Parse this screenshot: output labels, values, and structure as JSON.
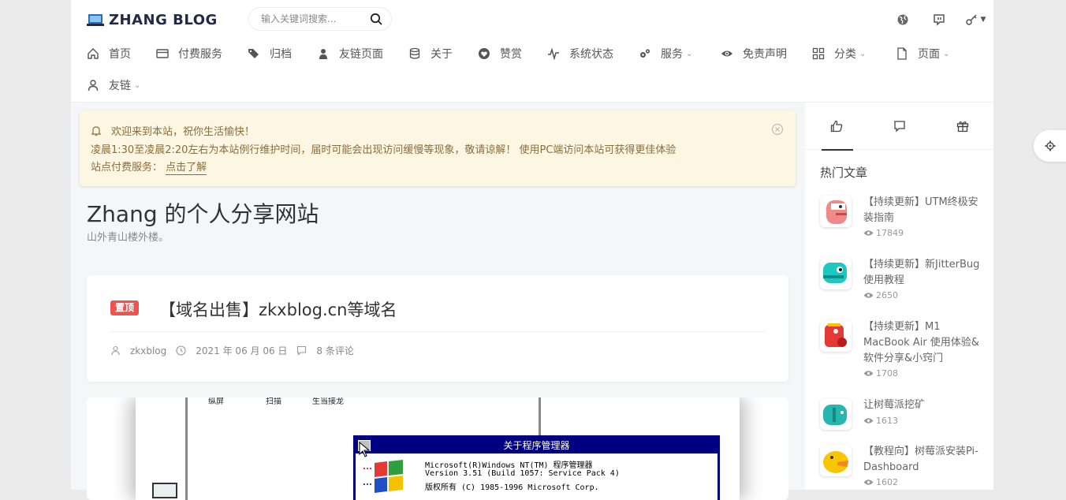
{
  "header": {
    "logo_text": "ZHANG BLOG",
    "search_placeholder": "输入关键词搜索...",
    "right_icons": [
      "globe-icon",
      "chat-icon",
      "key-icon"
    ]
  },
  "nav": {
    "items": [
      {
        "label": "首页",
        "icon": "home-icon"
      },
      {
        "label": "付费服务",
        "icon": "card-icon"
      },
      {
        "label": "归档",
        "icon": "tags-icon"
      },
      {
        "label": "友链页面",
        "icon": "user-icon"
      },
      {
        "label": "关于",
        "icon": "database-icon"
      },
      {
        "label": "赞赏",
        "icon": "heart-icon"
      },
      {
        "label": "系统状态",
        "icon": "pulse-icon"
      },
      {
        "label": "服务",
        "icon": "cogs-icon",
        "dropdown": true
      },
      {
        "label": "免责声明",
        "icon": "eye-icon"
      },
      {
        "label": "分类",
        "icon": "grid-icon",
        "dropdown": true
      },
      {
        "label": "页面",
        "icon": "file-icon",
        "dropdown": true
      },
      {
        "label": "友链",
        "icon": "person-icon",
        "dropdown": true
      }
    ]
  },
  "notice": {
    "line1": "欢迎来到本站，祝你生活愉快！",
    "line2": "凌晨1:30至凌晨2:20左右为本站例行维护时间，届时可能会出现访问缓慢等现象，敬请谅解！ 使用PC端访问本站可获得更佳体验",
    "line3_prefix": "站点付费服务：",
    "line3_link": "点击了解"
  },
  "hero": {
    "title": "Zhang 的个人分享网站",
    "subtitle": "山外青山楼外楼。"
  },
  "post": {
    "badge": "置顶",
    "title": "【域名出售】zkxblog.cn等域名",
    "author": "zkxblog",
    "date": "2021 年 06 月 06 日",
    "comments": "8 条评论"
  },
  "screenshot": {
    "top_texts": [
      "纵屏",
      "扫描",
      "生当接龙"
    ],
    "dialog_title": "关于程序管理器",
    "dialog_line1": "Microsoft(R)Windows NT(TM) 程序管理器",
    "dialog_line2": "Version 3.51 (Build 1057: Service Pack 4)",
    "dialog_line3": "版权所有 (C) 1985-1996 Microsoft Corp."
  },
  "sidebar": {
    "tabs": [
      "thumbs-up-icon",
      "comment-icon",
      "gift-icon"
    ],
    "section_title": "热门文章",
    "posts": [
      {
        "title": "【持续更新】UTM终极安装指南",
        "views": "17849",
        "color": "#f08a8a"
      },
      {
        "title": "【持续更新】新JitterBug使用教程",
        "views": "2650",
        "color": "#1ec8c0"
      },
      {
        "title": "【持续更新】M1 MacBook Air 使用体验&软件分享&小窍门",
        "views": "1708",
        "color": "#e53935"
      },
      {
        "title": "让树莓派挖矿",
        "views": "1613",
        "color": "#26b5b0"
      },
      {
        "title": "【教程向】树莓派安装Pi-Dashboard",
        "views": "1602",
        "color": "#f7c600"
      }
    ]
  }
}
